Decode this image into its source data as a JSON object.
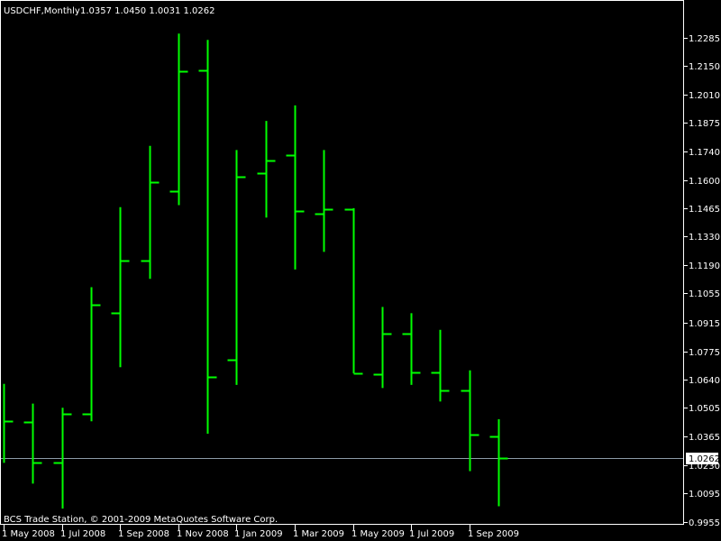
{
  "header": {
    "symbol_timeframe": "USDCHF,Monthly",
    "ohlc": "1.0357 1.0450 1.0031 1.0262"
  },
  "footer": {
    "copyright": "BCS Trade Station, © 2001-2009 MetaQuotes Software Corp."
  },
  "colors": {
    "background": "#000000",
    "bars": "#00ff00",
    "price_line": "#8c9aa8",
    "frame": "#ffffff",
    "current_price_label_bg": "#ffffff",
    "current_price_label_text": "#000000"
  },
  "chart_data": {
    "type": "ohlc",
    "title": "USDCHF,Monthly",
    "current_price": 1.0262,
    "current_price_label": "1.0262",
    "ylim": [
      0.9955,
      1.2315
    ],
    "y_ticks": [
      "1.2285",
      "1.2150",
      "1.2010",
      "1.1875",
      "1.1740",
      "1.1600",
      "1.1465",
      "1.1330",
      "1.1190",
      "1.1055",
      "1.0915",
      "1.0775",
      "1.0640",
      "1.0505",
      "1.0365",
      "1.0230",
      "1.0095",
      "0.9955"
    ],
    "x_ticks": [
      {
        "bar": 0,
        "label": "1 May 2008"
      },
      {
        "bar": 2,
        "label": "1 Jul 2008"
      },
      {
        "bar": 4,
        "label": "1 Sep 2008"
      },
      {
        "bar": 6,
        "label": "1 Nov 2008"
      },
      {
        "bar": 8,
        "label": "1 Jan 2009"
      },
      {
        "bar": 10,
        "label": "1 Mar 2009"
      },
      {
        "bar": 12,
        "label": "1 May 2009"
      },
      {
        "bar": 14,
        "label": "1 Jul 2009"
      },
      {
        "bar": 16,
        "label": "1 Sep 2009"
      }
    ],
    "bars": [
      {
        "o": 1.0439,
        "h": 1.062,
        "l": 1.024,
        "c": 1.0439
      },
      {
        "o": 1.0435,
        "h": 1.0525,
        "l": 1.014,
        "c": 1.024
      },
      {
        "o": 1.024,
        "h": 1.0505,
        "l": 1.002,
        "c": 1.0475
      },
      {
        "o": 1.0475,
        "h": 1.1085,
        "l": 1.044,
        "c": 1.1
      },
      {
        "o": 1.096,
        "h": 1.147,
        "l": 1.07,
        "c": 1.1215
      },
      {
        "o": 1.1215,
        "h": 1.1765,
        "l": 1.1125,
        "c": 1.159
      },
      {
        "o": 1.1545,
        "h": 1.2305,
        "l": 1.148,
        "c": 1.2125
      },
      {
        "o": 1.213,
        "h": 1.2275,
        "l": 1.038,
        "c": 1.0655
      },
      {
        "o": 1.0735,
        "h": 1.1745,
        "l": 1.0615,
        "c": 1.1615
      },
      {
        "o": 1.1635,
        "h": 1.1885,
        "l": 1.142,
        "c": 1.1695
      },
      {
        "o": 1.172,
        "h": 1.196,
        "l": 1.117,
        "c": 1.145
      },
      {
        "o": 1.144,
        "h": 1.1745,
        "l": 1.1255,
        "c": 1.146
      },
      {
        "o": 1.146,
        "h": 1.1465,
        "l": 1.067,
        "c": 1.067
      },
      {
        "o": 1.0665,
        "h": 1.099,
        "l": 1.06,
        "c": 1.086
      },
      {
        "o": 1.086,
        "h": 1.096,
        "l": 1.0615,
        "c": 1.0675
      },
      {
        "o": 1.0675,
        "h": 1.088,
        "l": 1.0535,
        "c": 1.059
      },
      {
        "o": 1.059,
        "h": 1.0685,
        "l": 1.02,
        "c": 1.0375
      },
      {
        "o": 1.0365,
        "h": 1.045,
        "l": 1.0031,
        "c": 1.0262
      }
    ]
  }
}
